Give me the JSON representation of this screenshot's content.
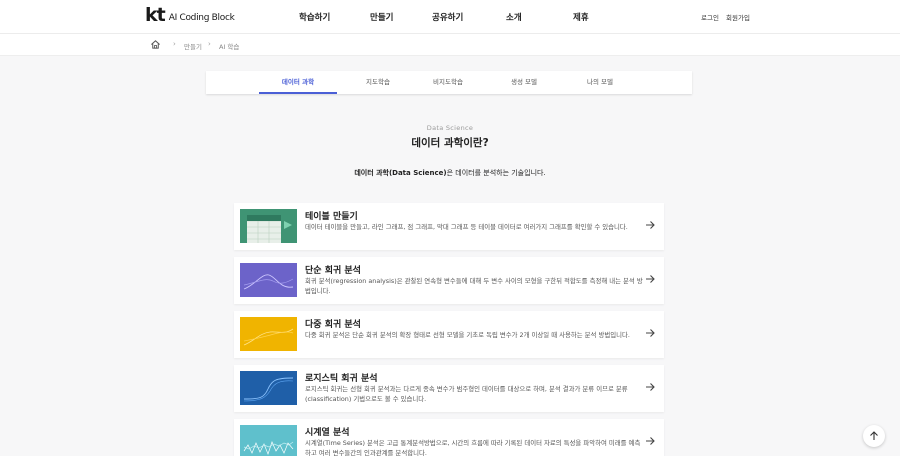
{
  "header": {
    "logo_mark": "kt",
    "logo_text": "AI Coding Block",
    "nav": [
      "학습하기",
      "만들기",
      "공유하기",
      "소개",
      "제휴"
    ],
    "login": "로그인",
    "signup": "회원가입"
  },
  "breadcrumb": {
    "home_icon": "home-icon",
    "items": [
      "만들기",
      "AI 학습"
    ]
  },
  "tabs": [
    "데이터 과학",
    "지도학습",
    "비지도학습",
    "생성 모델",
    "나의 모델"
  ],
  "active_tab": "데이터 과학",
  "intro": {
    "eyebrow": "Data Science",
    "title": "데이터 과학이란?",
    "desc_bold": "데이터 과학(Data Science)",
    "desc_rest": "은 데이터를 분석하는 기술입니다."
  },
  "cards": [
    {
      "title": "테이블 만들기",
      "text": "데이터 테이블을 만들고, 라인 그래프, 점 그래프, 막대 그래프 등 테이블 데이터로 여러가지 그래프를 확인할 수 있습니다.",
      "thumb_color": "#3f9474"
    },
    {
      "title": "단순 회귀 분석",
      "text": "회귀 분석(regression analysis)은 관찰된 연속형 변수들에 대해 두 변수 사이의 모형을 구한뒤 적합도를 측정해 내는 분석 방법입니다.",
      "thumb_color": "#6c63c9"
    },
    {
      "title": "다중 회귀 분석",
      "text": "다중 회귀 분석은 단순 회귀 분석의 확장 형태로 선형 모델을 기초로 독립 변수가 2개 이상일 때 사용하는 분석 방법입니다.",
      "thumb_color": "#f0b400"
    },
    {
      "title": "로지스틱 회귀 분석",
      "text": "로지스틱 회귀는 선형 회귀 분석과는 다르게 종속 변수가 범주형인 데이터를 대상으로 하며, 분석 결과가 분류 이므로 분류 (classification) 기법으로도 볼 수 있습니다.",
      "thumb_color": "#1f5fa8"
    },
    {
      "title": "시계열 분석",
      "text": "시계열(Time Series) 분석은 고급 통계분석방법으로, 시간의 흐름에 따라 기록된 데이터 자료의 특성을 파악하여 미래를 예측하고 여러 변수들간의 인과관계를 분석합니다.",
      "thumb_color": "#5fc0cc"
    }
  ],
  "icons": {
    "card_arrow": "arrow-right-icon",
    "scroll_top": "arrow-up-icon"
  }
}
